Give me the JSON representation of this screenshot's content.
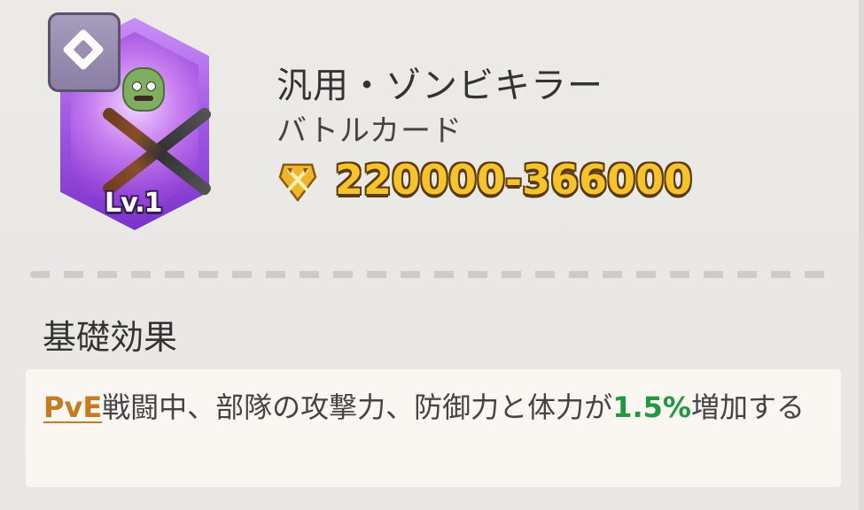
{
  "card": {
    "level_label": "Lv.1",
    "rarity_icon": "diamond-icon",
    "image_icon": "zombie-crossed-rifles-icon",
    "frame_color": "#a35ce6"
  },
  "header": {
    "title": "汎用・ゾンビキラー",
    "subtitle": "バトルカード",
    "power_icon": "crossed-swords-shield-icon",
    "power_range": "220000-366000",
    "power_color": "#f6c328"
  },
  "section": {
    "title": "基礎効果"
  },
  "effect": {
    "tag": "PvE",
    "text_main": "戦闘中、部隊の攻撃力、防御力と体力が",
    "value": "1.5%",
    "text_end": "増加する",
    "tag_color": "#c77a1e",
    "value_color": "#1f9a3e"
  }
}
